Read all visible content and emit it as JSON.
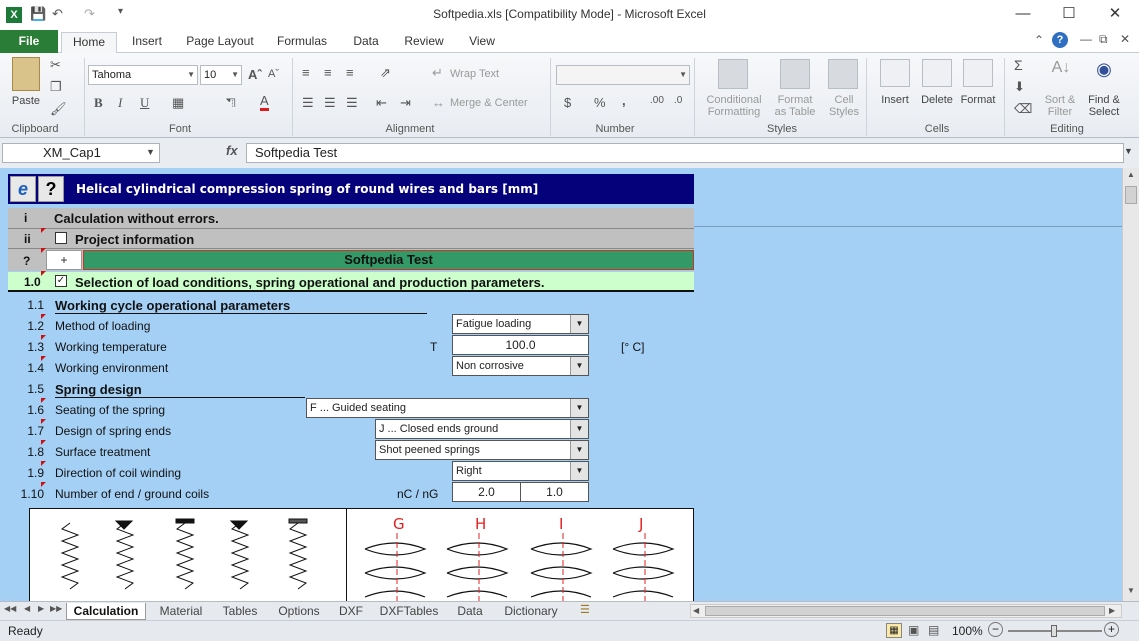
{
  "window": {
    "title": "Softpedia.xls  [Compatibility Mode]  -  Microsoft Excel"
  },
  "tabs": [
    "File",
    "Home",
    "Insert",
    "Page Layout",
    "Formulas",
    "Data",
    "Review",
    "View"
  ],
  "ribbon": {
    "clipboard": {
      "paste": "Paste",
      "group": "Clipboard"
    },
    "font": {
      "name": "Tahoma",
      "size": "10",
      "group": "Font"
    },
    "alignment": {
      "wrap": "Wrap Text",
      "merge": "Merge & Center",
      "group": "Alignment"
    },
    "number": {
      "currency": "$",
      "percent": "%",
      "comma": ",",
      "group": "Number"
    },
    "styles": {
      "cond1": "Conditional",
      "cond2": "Formatting",
      "fmt1": "Format",
      "fmt2": "as Table",
      "cell1": "Cell",
      "cell2": "Styles",
      "group": "Styles"
    },
    "cells": {
      "insert": "Insert",
      "delete": "Delete",
      "format": "Format",
      "group": "Cells"
    },
    "editing": {
      "sort1": "Sort &",
      "sort2": "Filter",
      "find1": "Find &",
      "find2": "Select",
      "group": "Editing"
    }
  },
  "formula_bar": {
    "name_box": "XM_Cap1",
    "fx": "fx",
    "value": "Softpedia Test"
  },
  "sheet": {
    "header": "Helical cylindrical compression spring of round wires and bars [mm]",
    "row_i": {
      "num": "i",
      "text": "Calculation without errors."
    },
    "row_ii": {
      "num": "ii",
      "text": "Project information"
    },
    "row_q": {
      "num": "?",
      "plus": "+",
      "text": "Softpedia Test"
    },
    "row_10": {
      "num": "1.0",
      "text": "Selection of load conditions, spring operational and production parameters."
    },
    "rows": [
      {
        "num": "1.1",
        "label": "Working cycle operational parameters"
      },
      {
        "num": "1.2",
        "label": "Method of loading",
        "value": "Fatigue loading"
      },
      {
        "num": "1.3",
        "label": "Working temperature",
        "sym": "T",
        "value": "100.0",
        "unit": "[° C]"
      },
      {
        "num": "1.4",
        "label": "Working environment",
        "value": "Non corrosive"
      },
      {
        "num": "1.5",
        "label": "Spring design"
      },
      {
        "num": "1.6",
        "label": "Seating of the spring",
        "value": "F ... Guided seating"
      },
      {
        "num": "1.7",
        "label": "Design of spring ends",
        "value": "J  ... Closed ends ground"
      },
      {
        "num": "1.8",
        "label": "Surface treatment",
        "value": "Shot peened springs"
      },
      {
        "num": "1.9",
        "label": "Direction of coil winding",
        "value": "Right"
      },
      {
        "num": "1.10",
        "label": "Number of end / ground coils",
        "sym": "nC / nG",
        "value": "2.0",
        "value2": "1.0"
      }
    ],
    "ends": [
      "G",
      "H",
      "I",
      "J"
    ]
  },
  "sheet_tabs": [
    "Calculation",
    "Material",
    "Tables",
    "Options",
    "DXF",
    "DXFTables",
    "Data",
    "Dictionary"
  ],
  "status": {
    "text": "Ready",
    "zoom": "100%"
  }
}
